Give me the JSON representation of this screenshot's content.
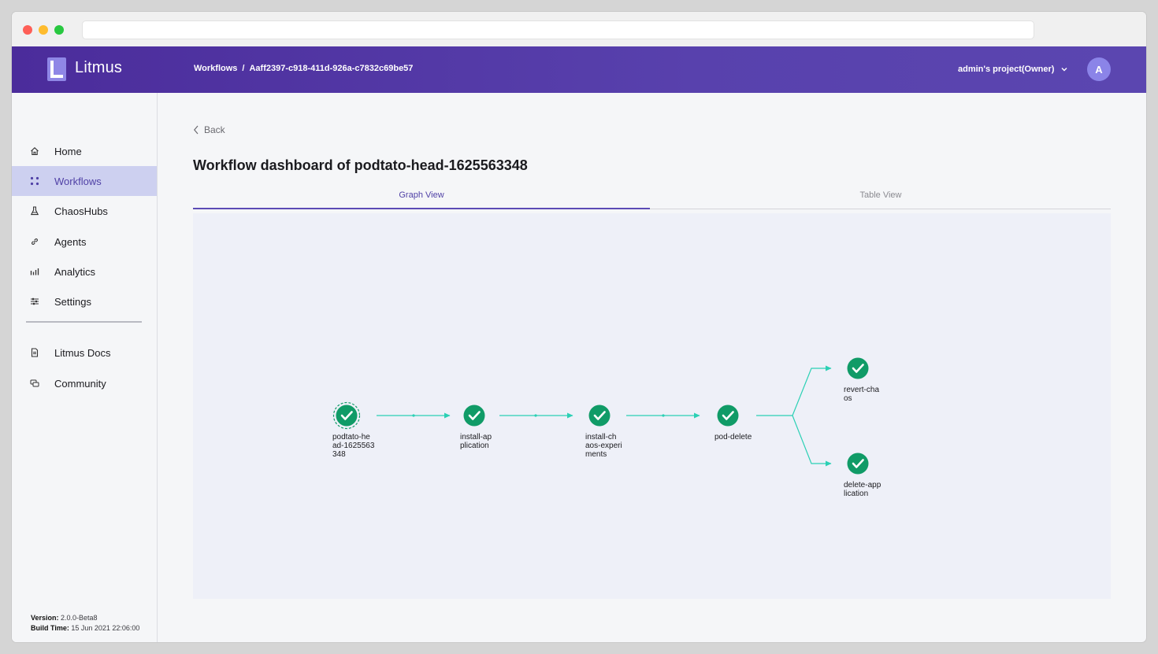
{
  "app": {
    "name": "Litmus"
  },
  "breadcrumb": {
    "section": "Workflows",
    "separator": "/",
    "current": "Aaff2397-c918-411d-926a-c7832c69be57"
  },
  "header": {
    "project": "admin's project(Owner)",
    "avatar_initial": "A"
  },
  "sidebar": {
    "items": [
      {
        "label": "Home",
        "icon": "home-icon"
      },
      {
        "label": "Workflows",
        "icon": "workflows-icon",
        "active": true
      },
      {
        "label": "ChaosHubs",
        "icon": "flask-icon"
      },
      {
        "label": "Agents",
        "icon": "link-icon"
      },
      {
        "label": "Analytics",
        "icon": "analytics-icon"
      },
      {
        "label": "Settings",
        "icon": "settings-icon"
      }
    ],
    "bottom_items": [
      {
        "label": "Litmus Docs",
        "icon": "document-icon"
      },
      {
        "label": "Community",
        "icon": "community-icon"
      }
    ],
    "version_label": "Version:",
    "version_value": "2.0.0-Beta8",
    "build_label": "Build Time:",
    "build_value": "15 Jun 2021 22:06:00"
  },
  "main": {
    "back_label": "Back",
    "title": "Workflow dashboard of podtato-head-1625563348",
    "tabs": [
      {
        "label": "Graph View",
        "active": true
      },
      {
        "label": "Table View",
        "active": false
      }
    ]
  },
  "graph": {
    "status_color": "#109b67",
    "edge_color": "#2bd0b4",
    "nodes": [
      {
        "id": "podtato-head-1625563348",
        "label_lines": [
          "podtato-he",
          "ad-1625563",
          "348"
        ],
        "status": "succeeded"
      },
      {
        "id": "install-application",
        "label_lines": [
          "install-ap",
          "plication"
        ],
        "status": "succeeded"
      },
      {
        "id": "install-chaos-experiments",
        "label_lines": [
          "install-ch",
          "aos-experi",
          "ments"
        ],
        "status": "succeeded"
      },
      {
        "id": "pod-delete",
        "label_lines": [
          "pod-delete"
        ],
        "status": "succeeded"
      },
      {
        "id": "revert-chaos",
        "label_lines": [
          "revert-cha",
          "os"
        ],
        "status": "succeeded"
      },
      {
        "id": "delete-application",
        "label_lines": [
          "delete-app",
          "lication"
        ],
        "status": "succeeded"
      }
    ]
  }
}
